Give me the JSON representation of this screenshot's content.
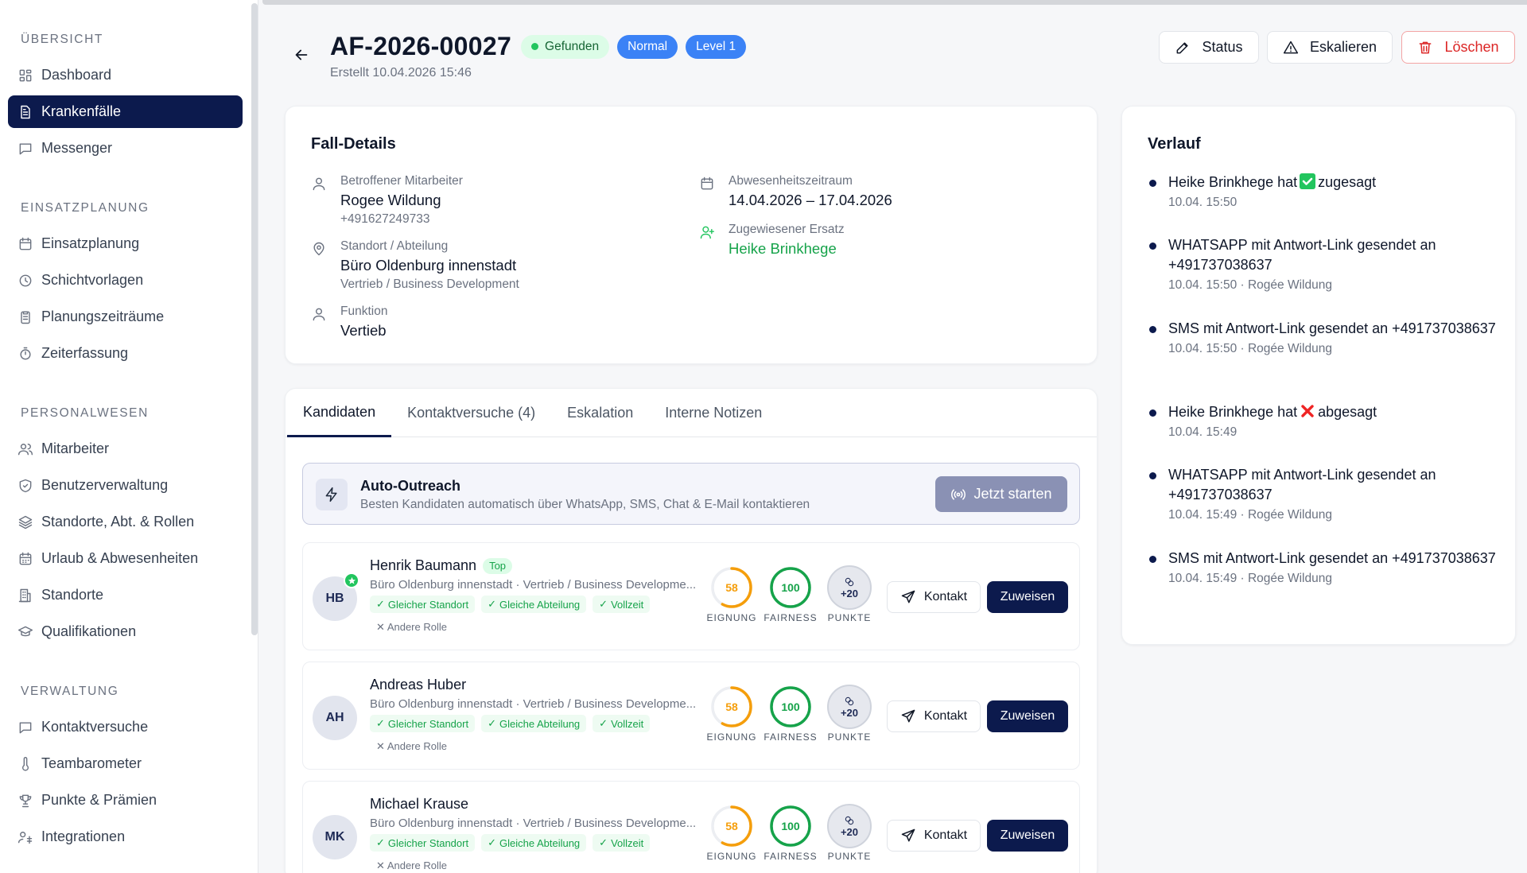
{
  "sidebar": {
    "sections": [
      {
        "title": "ÜBERSICHT",
        "items": [
          {
            "label": "Dashboard",
            "icon": "dashboard-icon"
          },
          {
            "label": "Krankenfälle",
            "icon": "document-icon",
            "active": true
          },
          {
            "label": "Messenger",
            "icon": "message-icon"
          }
        ]
      },
      {
        "title": "EINSATZPLANUNG",
        "items": [
          {
            "label": "Einsatzplanung",
            "icon": "calendar-icon"
          },
          {
            "label": "Schichtvorlagen",
            "icon": "clock-icon"
          },
          {
            "label": "Planungszeiträume",
            "icon": "clipboard-icon"
          },
          {
            "label": "Zeiterfassung",
            "icon": "stopwatch-icon"
          }
        ]
      },
      {
        "title": "PERSONALWESEN",
        "items": [
          {
            "label": "Mitarbeiter",
            "icon": "users-icon"
          },
          {
            "label": "Benutzerverwaltung",
            "icon": "shield-icon"
          },
          {
            "label": "Standorte, Abt. & Rollen",
            "icon": "layers-icon"
          },
          {
            "label": "Urlaub & Abwesenheiten",
            "icon": "calendar-days-icon"
          },
          {
            "label": "Standorte",
            "icon": "building-icon"
          },
          {
            "label": "Qualifikationen",
            "icon": "graduation-cap-icon"
          }
        ]
      },
      {
        "title": "VERWALTUNG",
        "items": [
          {
            "label": "Kontaktversuche",
            "icon": "message-icon"
          },
          {
            "label": "Teambarometer",
            "icon": "thermometer-icon"
          },
          {
            "label": "Punkte & Prämien",
            "icon": "trophy-icon"
          },
          {
            "label": "Integrationen",
            "icon": "integration-icon"
          }
        ]
      }
    ]
  },
  "header": {
    "title": "AF-2026-00027",
    "badges": {
      "status": "Gefunden",
      "priority": "Normal",
      "level": "Level 1"
    },
    "created": "Erstellt 10.04.2026 15:46",
    "buttons": {
      "status": "Status",
      "escalate": "Eskalieren",
      "delete": "Löschen"
    }
  },
  "details": {
    "title": "Fall-Details",
    "employee": {
      "label": "Betroffener Mitarbeiter",
      "name": "Rogee Wildung",
      "phone": "+491627249733"
    },
    "location": {
      "label": "Standort / Abteilung",
      "value": "Büro Oldenburg innenstadt",
      "sub": "Vertrieb / Business Development"
    },
    "function": {
      "label": "Funktion",
      "value": "Vertieb"
    },
    "period": {
      "label": "Abwesenheitszeitraum",
      "value": "14.04.2026 – 17.04.2026"
    },
    "replacement": {
      "label": "Zugewiesener Ersatz",
      "value": "Heike Brinkhege"
    }
  },
  "tabs": [
    "Kandidaten",
    "Kontaktversuche (4)",
    "Eskalation",
    "Interne Notizen"
  ],
  "outreach": {
    "title": "Auto-Outreach",
    "subtitle": "Besten Kandidaten automatisch über WhatsApp, SMS, Chat & E-Mail kontaktieren",
    "button": "Jetzt starten"
  },
  "candidates": [
    {
      "initials": "HB",
      "name": "Henrik Baumann",
      "tag": "Top",
      "location": "Büro Oldenburg innenstadt · Vertrieb / Business Developme...",
      "chips": [
        "Gleicher Standort",
        "Gleiche Abteilung",
        "Vollzeit"
      ],
      "other": "Andere Rolle",
      "eignung": 58,
      "fairness": 100,
      "punkte": "+20"
    },
    {
      "initials": "AH",
      "name": "Andreas Huber",
      "tag": "",
      "location": "Büro Oldenburg innenstadt · Vertrieb / Business Developme...",
      "chips": [
        "Gleicher Standort",
        "Gleiche Abteilung",
        "Vollzeit"
      ],
      "other": "Andere Rolle",
      "eignung": 58,
      "fairness": 100,
      "punkte": "+20"
    },
    {
      "initials": "MK",
      "name": "Michael Krause",
      "tag": "",
      "location": "Büro Oldenburg innenstadt · Vertrieb / Business Developme...",
      "chips": [
        "Gleicher Standort",
        "Gleiche Abteilung",
        "Vollzeit"
      ],
      "other": "Andere Rolle",
      "eignung": 58,
      "fairness": 100,
      "punkte": "+20"
    }
  ],
  "metric_labels": {
    "eignung": "EIGNUNG",
    "fairness": "FAIRNESS",
    "punkte": "PUNKTE"
  },
  "candidate_buttons": {
    "contact": "Kontakt",
    "assign": "Zuweisen"
  },
  "verlauf": {
    "title": "Verlauf",
    "items": [
      {
        "pre": "Heike Brinkhege hat",
        "emoji": "check",
        "post": "zugesagt",
        "meta": "10.04. 15:50"
      },
      {
        "pre": "WHATSAPP mit Antwort-Link gesendet an +491737038637",
        "emoji": "",
        "post": "",
        "meta": "10.04. 15:50 · Rogée Wildung"
      },
      {
        "pre": "SMS mit Antwort-Link gesendet an +491737038637",
        "emoji": "",
        "post": "",
        "meta": "10.04. 15:50 · Rogée Wildung"
      },
      {
        "pre": "Heike Brinkhege hat",
        "emoji": "cross",
        "post": "abgesagt",
        "meta": "10.04. 15:49"
      },
      {
        "pre": "WHATSAPP mit Antwort-Link gesendet an +491737038637",
        "emoji": "",
        "post": "",
        "meta": "10.04. 15:49 · Rogée Wildung"
      },
      {
        "pre": "SMS mit Antwort-Link gesendet an +491737038637",
        "emoji": "",
        "post": "",
        "meta": "10.04. 15:49 · Rogée Wildung"
      }
    ]
  },
  "colors": {
    "primary": "#0c1a4d",
    "success": "#22c55e",
    "warning": "#f59e0b",
    "danger": "#dc2626",
    "badge_blue": "#3b82f6"
  }
}
